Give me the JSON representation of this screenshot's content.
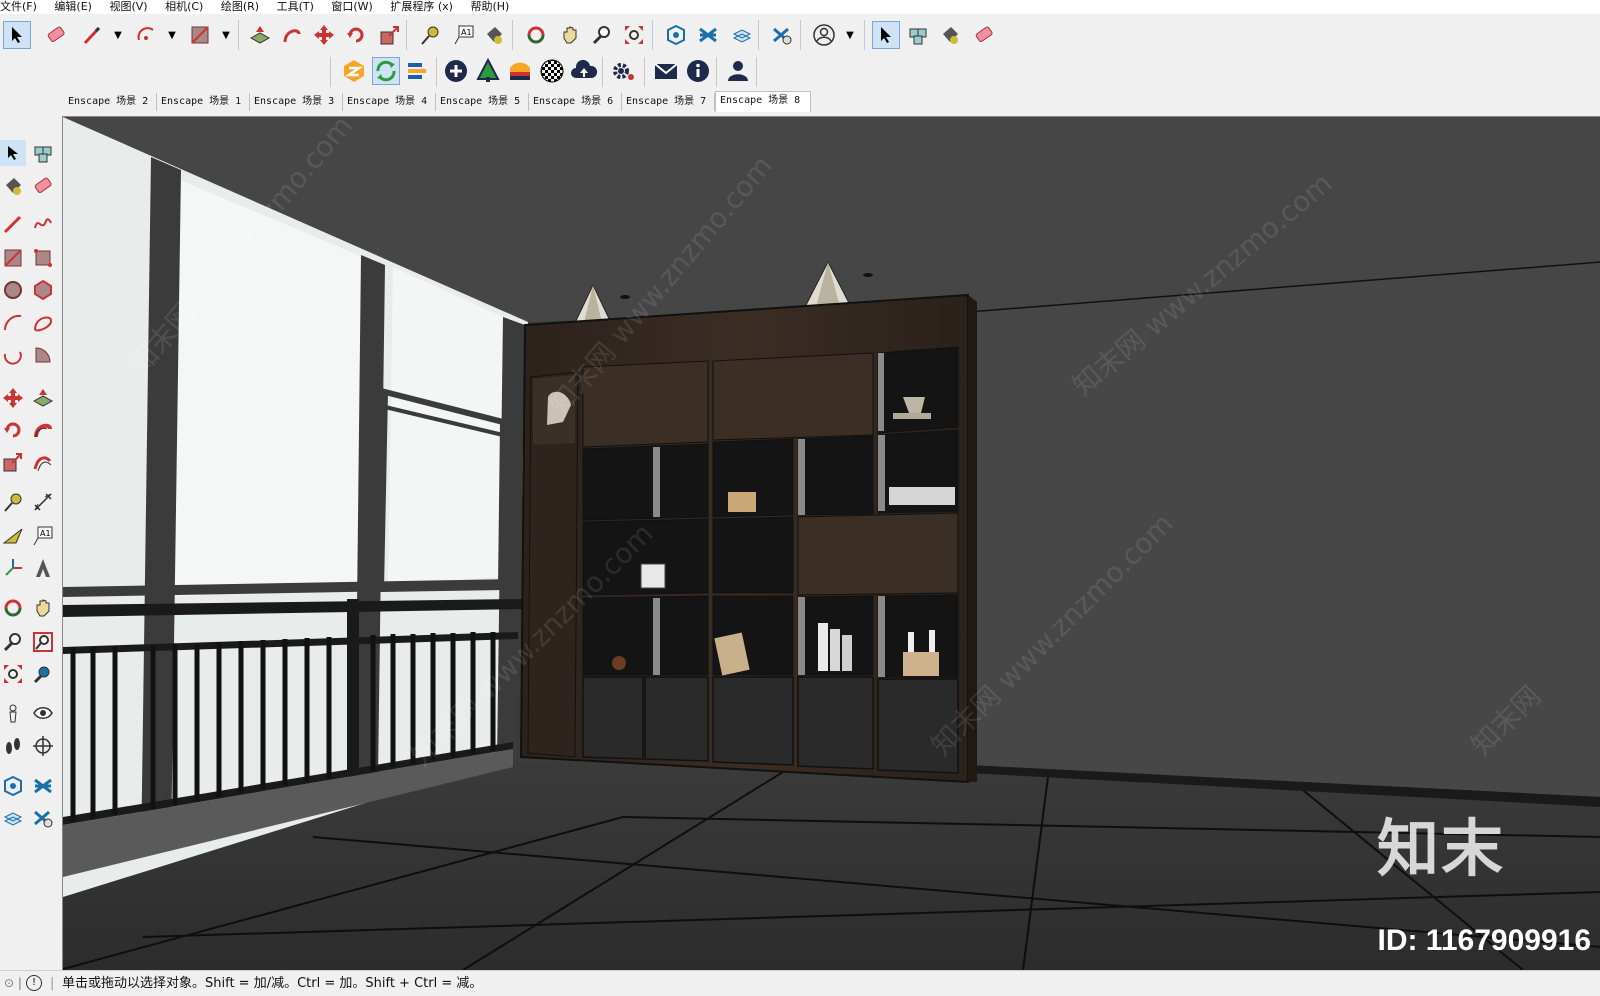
{
  "menu": [
    "文件(F)",
    "编辑(E)",
    "视图(V)",
    "相机(C)",
    "绘图(R)",
    "工具(T)",
    "窗口(W)",
    "扩展程序 (x)",
    "帮助(H)"
  ],
  "toolbar_icons": {
    "select": "select-arrow-icon",
    "eraser": "eraser-icon",
    "pencil": "pencil-icon",
    "arc": "arc-icon",
    "rectangle": "rectangle-icon",
    "pushpull": "push-pull-icon",
    "followme": "follow-me-icon",
    "move": "move-icon",
    "rotate": "rotate-icon",
    "scale": "scale-icon",
    "tape": "tape-measure-icon",
    "text": "text-icon",
    "paint": "paint-bucket-icon",
    "orbit": "orbit-icon",
    "pan": "pan-icon",
    "zoom": "zoom-icon",
    "zoom_extents": "zoom-extents-icon",
    "warehouse": "3d-warehouse-icon",
    "extension": "extension-warehouse-icon",
    "layout": "layout-icon",
    "ext_manager": "extension-manager-icon",
    "account": "account-icon"
  },
  "enscape_toolbar": [
    "start-enscape-icon",
    "live-update-icon",
    "sync-views-icon",
    "add-icon",
    "tree-icon",
    "materials-icon",
    "checker-icon",
    "upload-icon",
    "settings-icon",
    "feedback-icon",
    "info-icon",
    "account-icon"
  ],
  "scene_tabs": [
    "Enscape 场景 2",
    "Enscape 场景 1",
    "Enscape 场景 3",
    "Enscape 场景 4",
    "Enscape 场景 5",
    "Enscape 场景 6",
    "Enscape 场景 7",
    "Enscape 场景 8"
  ],
  "active_scene": "Enscape 场景 8",
  "status": {
    "text": "单击或拖动以选择对象。Shift = 加/减。Ctrl = 加。Shift + Ctrl = 减。"
  },
  "watermark": {
    "logo": "知末",
    "id": "ID: 1167909916",
    "text": "知末网 www.znzmo.com"
  }
}
